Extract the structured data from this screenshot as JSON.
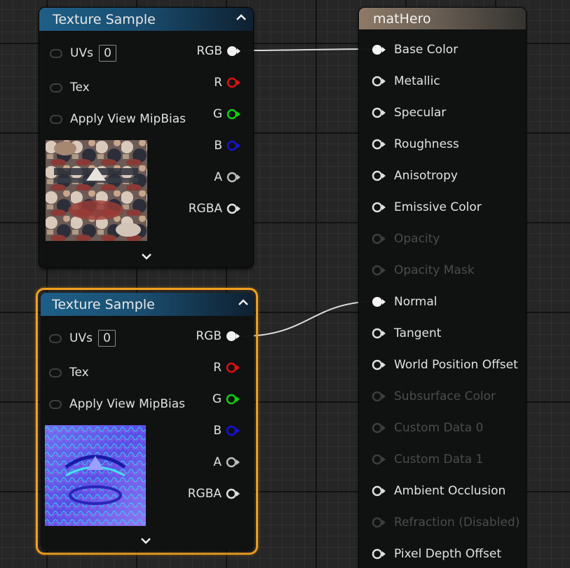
{
  "texture_nodes": [
    {
      "title": "Texture Sample",
      "inputs": {
        "uvs": "UVs",
        "uvs_value": "0",
        "tex": "Tex",
        "mip_bias": "Apply View MipBias"
      },
      "outputs": {
        "rgb": "RGB",
        "r": "R",
        "g": "G",
        "b": "B",
        "a": "A",
        "rgba": "RGBA"
      },
      "preview": "diffuse-texture-preview",
      "selected": false
    },
    {
      "title": "Texture Sample",
      "inputs": {
        "uvs": "UVs",
        "uvs_value": "0",
        "tex": "Tex",
        "mip_bias": "Apply View MipBias"
      },
      "outputs": {
        "rgb": "RGB",
        "r": "R",
        "g": "G",
        "b": "B",
        "a": "A",
        "rgba": "RGBA"
      },
      "preview": "normal-map-preview",
      "selected": true
    }
  ],
  "material_node": {
    "title": "matHero",
    "pins": [
      {
        "label": "Base Color",
        "enabled": true,
        "connected": true
      },
      {
        "label": "Metallic",
        "enabled": true,
        "connected": false
      },
      {
        "label": "Specular",
        "enabled": true,
        "connected": false
      },
      {
        "label": "Roughness",
        "enabled": true,
        "connected": false
      },
      {
        "label": "Anisotropy",
        "enabled": true,
        "connected": false
      },
      {
        "label": "Emissive Color",
        "enabled": true,
        "connected": false
      },
      {
        "label": "Opacity",
        "enabled": false,
        "connected": false
      },
      {
        "label": "Opacity Mask",
        "enabled": false,
        "connected": false
      },
      {
        "label": "Normal",
        "enabled": true,
        "connected": true
      },
      {
        "label": "Tangent",
        "enabled": true,
        "connected": false
      },
      {
        "label": "World Position Offset",
        "enabled": true,
        "connected": false
      },
      {
        "label": "Subsurface Color",
        "enabled": false,
        "connected": false
      },
      {
        "label": "Custom Data 0",
        "enabled": false,
        "connected": false
      },
      {
        "label": "Custom Data 1",
        "enabled": false,
        "connected": false
      },
      {
        "label": "Ambient Occlusion",
        "enabled": true,
        "connected": false
      },
      {
        "label": "Refraction (Disabled)",
        "enabled": false,
        "connected": false
      },
      {
        "label": "Pixel Depth Offset",
        "enabled": true,
        "connected": false
      }
    ]
  },
  "colors": {
    "channel_r": "#e01010",
    "channel_g": "#10d010",
    "channel_b": "#1414d8",
    "selection": "#f0a01e",
    "disabled_text": "#4a4d4d"
  }
}
